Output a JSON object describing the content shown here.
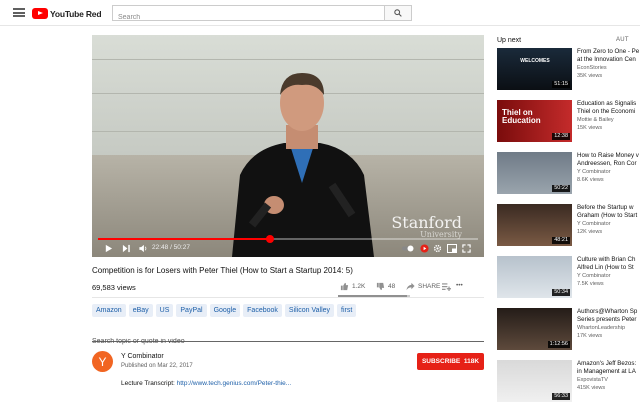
{
  "header": {
    "logo_text": "YouTube Red",
    "search_placeholder": "Search"
  },
  "player": {
    "watermark": "Stanford",
    "watermark_sub": "University",
    "current_time": "22:48",
    "duration": "50:27",
    "time_display": "22:48 / 50:27",
    "progress_fraction": 0.452
  },
  "video": {
    "title": "Competition is for Losers with Peter Thiel (How to Start a Startup 2014: 5)",
    "views": "69,583 views",
    "likes": "1.2K",
    "dislikes": "48",
    "share_label": "SHARE",
    "more_label": "•••",
    "like_fraction": 0.96
  },
  "tags": [
    "Amazon",
    "eBay",
    "US",
    "PayPal",
    "Google",
    "Facebook",
    "Silicon Valley",
    "first"
  ],
  "transcript_search": {
    "placeholder": "Search topic or quote in video"
  },
  "channel": {
    "avatar_letter": "Y",
    "name": "Y Combinator",
    "published": "Published on Mar 22, 2017",
    "subscribe_label": "SUBSCRIBE",
    "subscriber_count": "118K",
    "subscribe_text": "SUBSCRIBE  118K",
    "description_prefix": "Lecture Transcript: ",
    "description_link": "http://www.tech.genius.com/Peter-thie..."
  },
  "sidebar": {
    "up_next_label": "Up next",
    "autoplay_label": "AUT",
    "recommendations": [
      {
        "title": "From Zero to One - Pe",
        "title2": "at the Innovation Cen",
        "channel": "EconStories",
        "views": "35K views",
        "duration": "51:15",
        "thumb_text": "WELCOMES"
      },
      {
        "title": "Education as Signalis",
        "title2": "Thiel on the Economi",
        "channel": "Mottie & Bailey",
        "views": "15K views",
        "duration": "12:38",
        "thumb_text": "Thiel on Education"
      },
      {
        "title": "How to Raise Money v",
        "title2": "Andreessen, Ron Cor",
        "channel": "Y Combinator",
        "views": "8.6K views",
        "duration": "50:22",
        "thumb_text": ""
      },
      {
        "title": "Before the Startup w",
        "title2": "Graham (How to Start",
        "channel": "Y Combinator",
        "views": "12K views",
        "duration": "48:21",
        "thumb_text": ""
      },
      {
        "title": "Culture with Brian Ch",
        "title2": "Alfred Lin (How to St",
        "channel": "Y Combinator",
        "views": "7.5K views",
        "duration": "50:34",
        "thumb_text": ""
      },
      {
        "title": "Authors@Wharton Sp",
        "title2": "Series presents Peter",
        "channel": "WhartonLeadership",
        "views": "17K views",
        "duration": "1:12:56",
        "thumb_text": ""
      },
      {
        "title": "Amazon's Jeff Bezos:",
        "title2": "in Management at LA",
        "channel": "ExpovistaTV",
        "views": "415K views",
        "duration": "56:33",
        "thumb_text": ""
      }
    ]
  },
  "colors": {
    "brand_red": "#ff0000",
    "subscribe_red": "#e62117",
    "link_blue": "#1d5fa8",
    "tag_bg": "#e8eef7"
  }
}
